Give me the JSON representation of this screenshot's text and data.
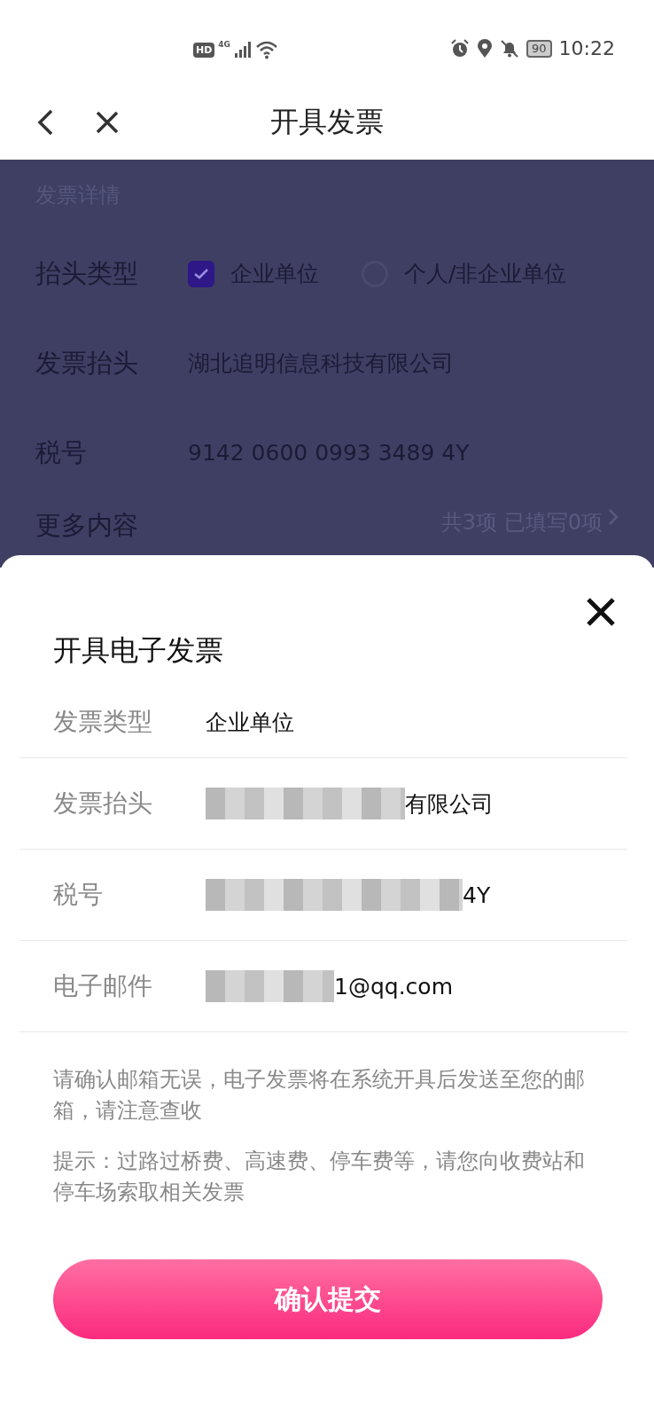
{
  "status_bar": {
    "hd_badge": "HD",
    "network": "4G",
    "battery": "90",
    "time": "10:22"
  },
  "nav": {
    "title": "开具发票"
  },
  "details": {
    "section_title": "发票详情",
    "header_type": {
      "label": "抬头类型",
      "options": [
        {
          "label": "企业单位",
          "selected": true
        },
        {
          "label": "个人/非企业单位",
          "selected": false
        }
      ]
    },
    "fields": [
      {
        "label": "发票抬头",
        "value": "湖北追明信息科技有限公司"
      },
      {
        "label": "税号",
        "value": "9142 0600 0993 3489 4Y"
      }
    ],
    "more": {
      "label": "更多内容",
      "summary": "共3项 已填写0项"
    }
  },
  "sheet": {
    "title": "开具电子发票",
    "rows": [
      {
        "label": "发票类型",
        "value": "企业单位",
        "redacted": false
      },
      {
        "label": "发票抬头",
        "value": "有限公司",
        "redacted": true
      },
      {
        "label": "税号",
        "value": "4Y",
        "redacted": true
      },
      {
        "label": "电子邮件",
        "value": "1@qq.com",
        "redacted": true
      }
    ],
    "notes": [
      "请确认邮箱无误，电子发票将在系统开具后发送至您的邮箱，请注意查收",
      "提示：过路过桥费、高速费、停车费等，请您向收费站和停车场索取相关发票"
    ],
    "submit": "确认提交"
  }
}
